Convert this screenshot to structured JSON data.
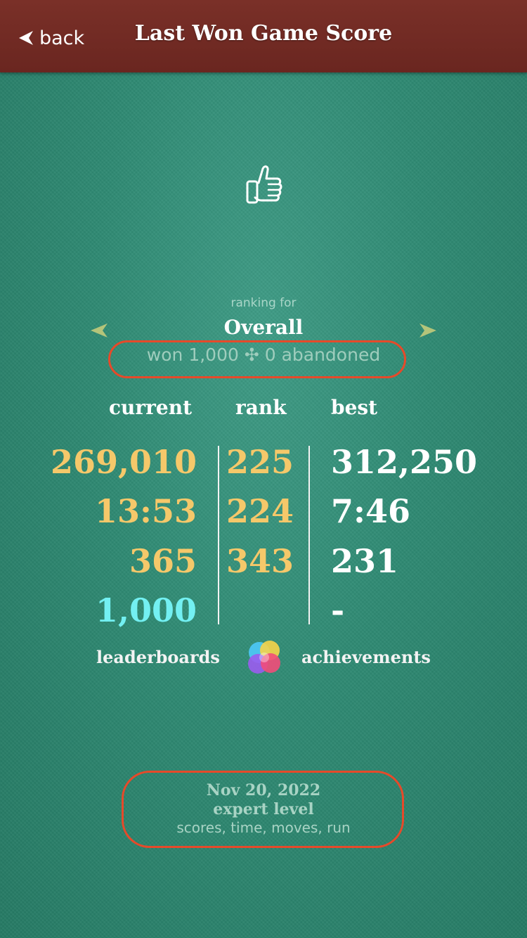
{
  "nav": {
    "back_label": "back",
    "title": "Last Won Game Score"
  },
  "ranking": {
    "caption": "ranking for",
    "category": "Overall",
    "won_line": "won 1,000 ✣ 0 abandoned"
  },
  "columns": {
    "current": "current",
    "rank": "rank",
    "best": "best"
  },
  "rows": [
    {
      "current": "269,010",
      "rank": "225",
      "best": "312,250"
    },
    {
      "current": "13:53",
      "rank": "224",
      "best": "7:46"
    },
    {
      "current": "365",
      "rank": "343",
      "best": "231"
    },
    {
      "current": "1,000",
      "rank": "",
      "best": "-"
    }
  ],
  "links": {
    "leaderboards": "leaderboards",
    "achievements": "achievements"
  },
  "footer": {
    "date": "Nov 20, 2022",
    "level": "expert level",
    "criteria": "scores, time, moves, run"
  },
  "colors": {
    "accent_value": "#f5c86a",
    "highlight_value": "#73f0f2",
    "navbar": "#6a2620",
    "annotation": "#e64a2a"
  },
  "icons": [
    "back-arrow-icon",
    "thumbs-up-icon",
    "left-arrow-icon",
    "right-arrow-icon",
    "game-center-icon"
  ]
}
